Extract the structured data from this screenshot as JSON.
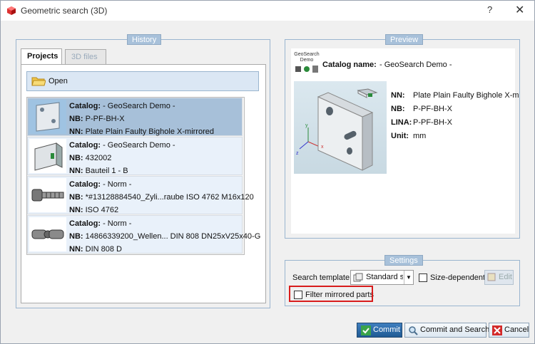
{
  "window": {
    "title": "Geometric search (3D)",
    "help_label": "?",
    "close_label": "✕"
  },
  "history": {
    "group_title": "History",
    "tabs": [
      {
        "label": "Projects"
      },
      {
        "label": "3D files"
      }
    ],
    "open_label": "Open",
    "items": [
      {
        "catalog_label": "Catalog:",
        "catalog": "- GeoSearch Demo -",
        "nb_label": "NB:",
        "nb": "P-PF-BH-X",
        "nn_label": "NN:",
        "nn": "Plate Plain Faulty Bighole X-mirrored",
        "thumb_icon": "plate-thumbnail-icon"
      },
      {
        "catalog_label": "Catalog:",
        "catalog": "- GeoSearch Demo -",
        "nb_label": "NB:",
        "nb": "432002",
        "nn_label": "NN:",
        "nn": "Bauteil 1 - B",
        "thumb_icon": "bracket-thumbnail-icon"
      },
      {
        "catalog_label": "Catalog:",
        "catalog": "- Norm -",
        "nb_label": "NB:",
        "nb": "*#13128884540_Zyli...raube ISO 4762 M16x120",
        "nn_label": "NN:",
        "nn": "ISO 4762",
        "thumb_icon": "screw-thumbnail-icon"
      },
      {
        "catalog_label": "Catalog:",
        "catalog": "- Norm -",
        "nb_label": "NB:",
        "nb": "14866339200_Wellen... DIN 808 DN25xV25x40-G",
        "nn_label": "NN:",
        "nn": "DIN 808 D",
        "thumb_icon": "joint-thumbnail-icon"
      }
    ]
  },
  "preview": {
    "group_title": "Preview",
    "logo_text_1": "GeoSearch",
    "logo_text_2": "Demo",
    "catalog_label": "Catalog name:",
    "catalog_value": "- GeoSearch Demo -",
    "fields": [
      {
        "label": "NN:",
        "value": "Plate Plain Faulty Bighole X-m"
      },
      {
        "label": "NB:",
        "value": "P-PF-BH-X"
      },
      {
        "label": "LINA:",
        "value": "P-PF-BH-X"
      },
      {
        "label": "Unit:",
        "value": "mm"
      }
    ],
    "axis_labels": [
      "x",
      "y",
      "z"
    ]
  },
  "settings": {
    "group_title": "Settings",
    "search_template_label": "Search template:",
    "search_template_value": "Standard se",
    "size_dependent_label": "Size-dependent",
    "size_dependent_checked": false,
    "edit_label": "Edit",
    "filter_mirrored_label": "Filter mirrored parts",
    "filter_mirrored_checked": false
  },
  "buttons": {
    "commit": "Commit",
    "commit_search": "Commit and Search",
    "cancel": "Cancel"
  },
  "colors": {
    "selected_row": "#a7c0d9",
    "group_title": "#a8c1da",
    "highlight": "#d81c1c"
  }
}
